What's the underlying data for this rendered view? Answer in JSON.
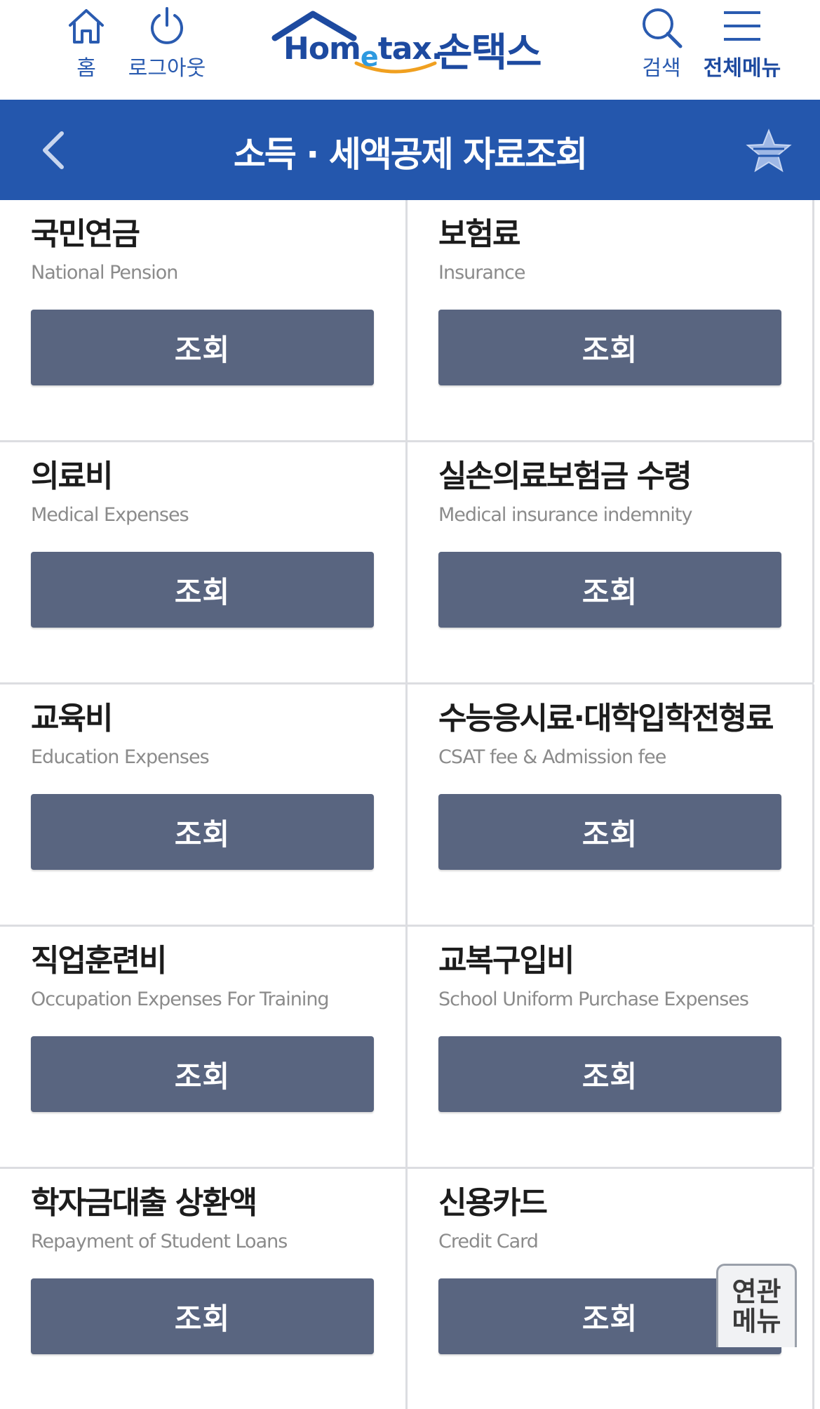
{
  "topbar": {
    "home_label": "홈",
    "logout_label": "로그아웃",
    "logo_text_en_1": "Hom",
    "logo_text_en_e": "e",
    "logo_text_en_2": "tax.",
    "logo_text_ko": "손택스",
    "search_label": "검색",
    "menu_label": "전체메뉴"
  },
  "header": {
    "title": "소득 · 세액공제 자료조회"
  },
  "items": [
    {
      "title": "국민연금",
      "subtitle": "National Pension",
      "button": "조회"
    },
    {
      "title": "보험료",
      "subtitle": "Insurance",
      "button": "조회"
    },
    {
      "title": "의료비",
      "subtitle": "Medical Expenses",
      "button": "조회"
    },
    {
      "title": "실손의료보험금 수령",
      "subtitle": "Medical insurance indemnity",
      "button": "조회"
    },
    {
      "title": "교육비",
      "subtitle": "Education Expenses",
      "button": "조회"
    },
    {
      "title": "수능응시료·대학입학전형료",
      "subtitle": "CSAT fee & Admission fee",
      "button": "조회"
    },
    {
      "title": "직업훈련비",
      "subtitle": "Occupation Expenses For Training",
      "button": "조회"
    },
    {
      "title": "교복구입비",
      "subtitle": "School Uniform Purchase Expenses",
      "button": "조회"
    },
    {
      "title": "학자금대출 상환액",
      "subtitle": "Repayment of Student Loans",
      "button": "조회"
    },
    {
      "title": "신용카드",
      "subtitle": "Credit Card",
      "button": "조회"
    }
  ],
  "related_menu": {
    "line1": "연관",
    "line2": "메뉴"
  },
  "colors": {
    "brand_blue": "#2457ad",
    "button_slate": "#596580",
    "icon_blue": "#2a5bb0"
  }
}
